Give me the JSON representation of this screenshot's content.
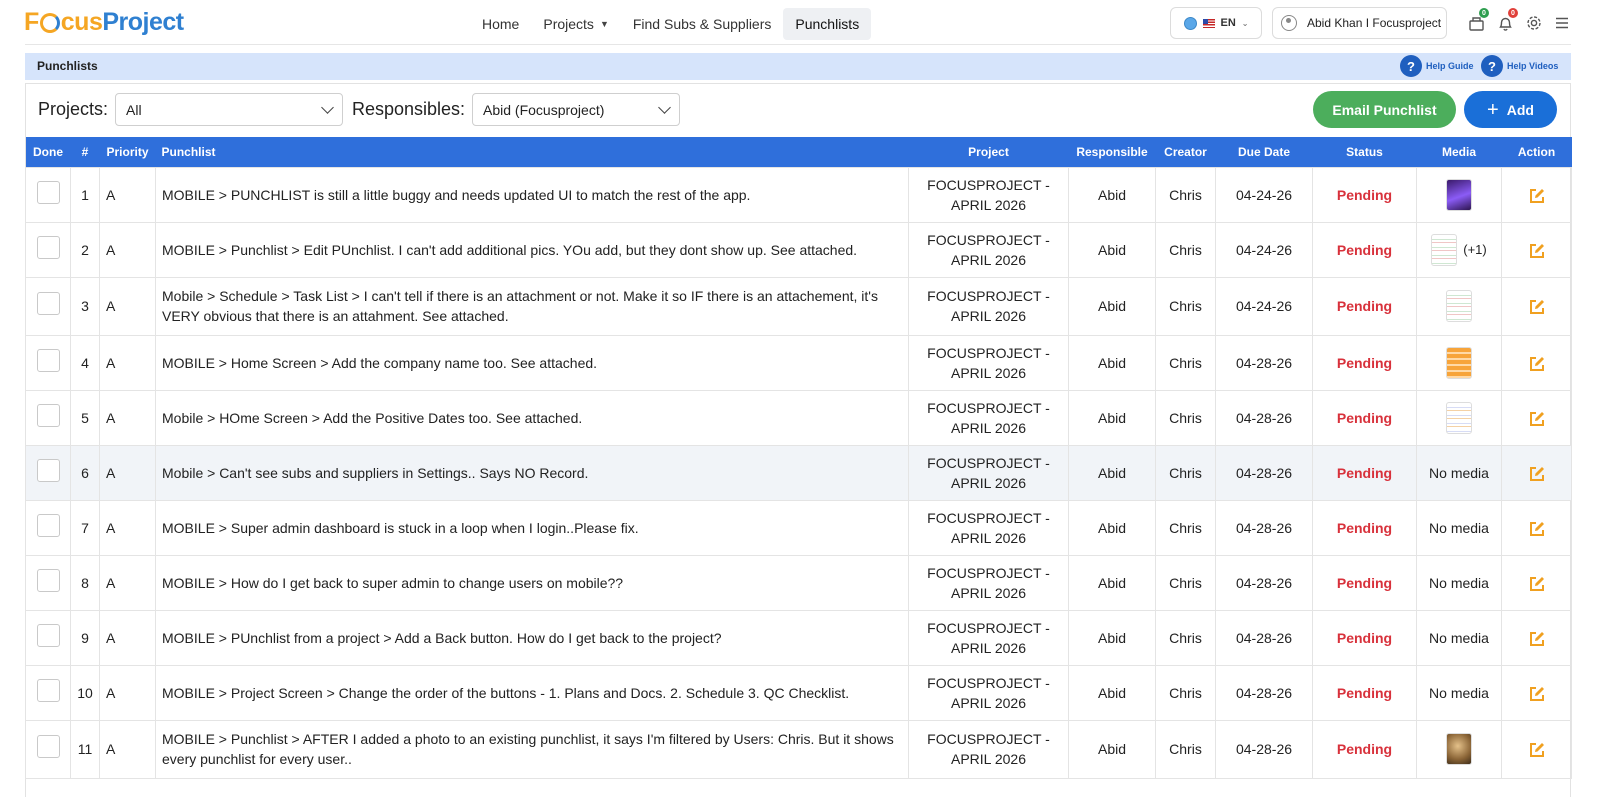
{
  "app": {
    "logo_part1": "F",
    "logo_part2": "cus",
    "logo_part3": "Project",
    "accent": "#2f6fdb",
    "brand_orange": "#f5a623",
    "brand_blue": "#2f80d1"
  },
  "nav": {
    "home": "Home",
    "projects": "Projects",
    "find_subs": "Find Subs & Suppliers",
    "punchlists": "Punchlists"
  },
  "header": {
    "language": "EN",
    "user_name": "Abid Khan I Focusproject",
    "task_badge": "0",
    "notification_badge": "0",
    "icons": [
      "globe-icon",
      "us-flag-icon",
      "user-icon",
      "task-icon",
      "bell-icon",
      "gear-icon",
      "menu-icon"
    ]
  },
  "section": {
    "title": "Punchlists",
    "help_guide": "Help Guide",
    "help_videos": "Help Videos"
  },
  "filters": {
    "projects_label": "Projects:",
    "projects_value": "All",
    "responsibles_label": "Responsibles:",
    "responsibles_value": "Abid (Focusproject)"
  },
  "actions": {
    "email_punchlist": "Email Punchlist",
    "add": "Add"
  },
  "table": {
    "columns": {
      "done": "Done",
      "num": "#",
      "priority": "Priority",
      "punchlist": "Punchlist",
      "project": "Project",
      "responsible": "Responsible",
      "creator": "Creator",
      "due_date": "Due Date",
      "status": "Status",
      "media": "Media",
      "action": "Action"
    },
    "rows": [
      {
        "num": "1",
        "priority": "A",
        "punchlist": "MOBILE > PUNCHLIST is still a little buggy and needs updated UI to match the rest of the app.",
        "project": "FOCUSPROJECT - APRIL 2026",
        "responsible": "Abid",
        "creator": "Chris",
        "due": "04-24-26",
        "status": "Pending",
        "media": "",
        "thumb": "t-purple",
        "extra": ""
      },
      {
        "num": "2",
        "priority": "A",
        "punchlist": "MOBILE > Punchlist > Edit PUnchlist. I can't add additional pics. YOu add, but they dont show up. See attached.",
        "project": "FOCUSPROJECT - APRIL 2026",
        "responsible": "Abid",
        "creator": "Chris",
        "due": "04-24-26",
        "status": "Pending",
        "media": "",
        "thumb": "t-list",
        "extra": "(+1)"
      },
      {
        "num": "3",
        "priority": "A",
        "punchlist": "Mobile > Schedule > Task List > I can't tell if there is an attachment or not. Make it so IF there is an attachement, it's VERY obvious that there is an attahment. See attached.",
        "project": "FOCUSPROJECT - APRIL 2026",
        "responsible": "Abid",
        "creator": "Chris",
        "due": "04-24-26",
        "status": "Pending",
        "media": "",
        "thumb": "t-list",
        "extra": ""
      },
      {
        "num": "4",
        "priority": "A",
        "punchlist": "MOBILE > Home Screen > Add the company name too. See attached.",
        "project": "FOCUSPROJECT - APRIL 2026",
        "responsible": "Abid",
        "creator": "Chris",
        "due": "04-28-26",
        "status": "Pending",
        "media": "",
        "thumb": "t-orange",
        "extra": ""
      },
      {
        "num": "5",
        "priority": "A",
        "punchlist": "Mobile > HOme Screen > Add the Positive Dates too. See attached.",
        "project": "FOCUSPROJECT - APRIL 2026",
        "responsible": "Abid",
        "creator": "Chris",
        "due": "04-28-26",
        "status": "Pending",
        "media": "",
        "thumb": "t-doc",
        "extra": ""
      },
      {
        "num": "6",
        "priority": "A",
        "punchlist": "Mobile > Can't see subs and suppliers in Settings.. Says NO Record.",
        "project": "FOCUSPROJECT - APRIL 2026",
        "responsible": "Abid",
        "creator": "Chris",
        "due": "04-28-26",
        "status": "Pending",
        "media": "No media",
        "thumb": "",
        "extra": ""
      },
      {
        "num": "7",
        "priority": "A",
        "punchlist": "MOBILE > Super admin dashboard is stuck in a loop when I login..Please fix.",
        "project": "FOCUSPROJECT - APRIL 2026",
        "responsible": "Abid",
        "creator": "Chris",
        "due": "04-28-26",
        "status": "Pending",
        "media": "No media",
        "thumb": "",
        "extra": ""
      },
      {
        "num": "8",
        "priority": "A",
        "punchlist": "MOBILE > How do I get back to super admin to change users on mobile??",
        "project": "FOCUSPROJECT - APRIL 2026",
        "responsible": "Abid",
        "creator": "Chris",
        "due": "04-28-26",
        "status": "Pending",
        "media": "No media",
        "thumb": "",
        "extra": ""
      },
      {
        "num": "9",
        "priority": "A",
        "punchlist": "MOBILE > PUnchlist from a project > Add a Back button. How do I get back to the project?",
        "project": "FOCUSPROJECT - APRIL 2026",
        "responsible": "Abid",
        "creator": "Chris",
        "due": "04-28-26",
        "status": "Pending",
        "media": "No media",
        "thumb": "",
        "extra": ""
      },
      {
        "num": "10",
        "priority": "A",
        "punchlist": "MOBILE > Project Screen > Change the order of the buttons - 1. Plans and Docs. 2. Schedule 3. QC Checklist.",
        "project": "FOCUSPROJECT - APRIL 2026",
        "responsible": "Abid",
        "creator": "Chris",
        "due": "04-28-26",
        "status": "Pending",
        "media": "No media",
        "thumb": "",
        "extra": ""
      },
      {
        "num": "11",
        "priority": "A",
        "punchlist": "MOBILE > Punchlist > AFTER I added a photo to an existing punchlist, it says I'm filtered by Users: Chris. But it shows every punchlist for every user..",
        "project": "FOCUSPROJECT - APRIL 2026",
        "responsible": "Abid",
        "creator": "Chris",
        "due": "04-28-26",
        "status": "Pending",
        "media": "",
        "thumb": "t-photo",
        "extra": ""
      }
    ]
  }
}
